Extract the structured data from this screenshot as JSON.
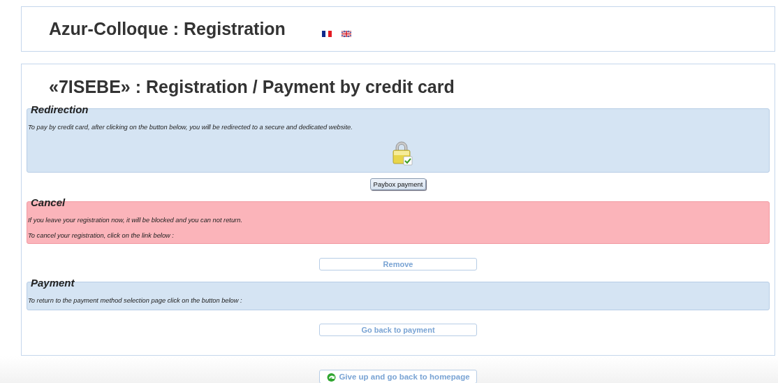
{
  "header": {
    "title": "Azur-Colloque : Registration",
    "languages": [
      {
        "kind": "fr"
      },
      {
        "kind": "en"
      }
    ]
  },
  "main": {
    "title": "«7ISEBE» : Registration / Payment by credit card",
    "sections": [
      {
        "kind": "info",
        "title": "Redirection",
        "paragraphs": [
          "To pay by credit card, after clicking on the button below, you will be redirected to a secure and dedicated website."
        ],
        "button": {
          "kind": "raised",
          "label": "Paybox payment"
        }
      },
      {
        "kind": "warning",
        "title": "Cancel",
        "paragraphs": [
          "If you leave your registration now, it will be blocked and you can not return.",
          "To cancel your registration, click on the link below :"
        ],
        "button": {
          "kind": "outline",
          "label": "Remove"
        }
      },
      {
        "kind": "info",
        "title": "Payment",
        "paragraphs": [
          "To return to the payment method selection page click on the button below :"
        ],
        "button": {
          "kind": "outline",
          "label": "Go back to payment"
        }
      }
    ]
  },
  "footer_button": {
    "kind": "outline",
    "label": "Give up and go back to homepage"
  }
}
